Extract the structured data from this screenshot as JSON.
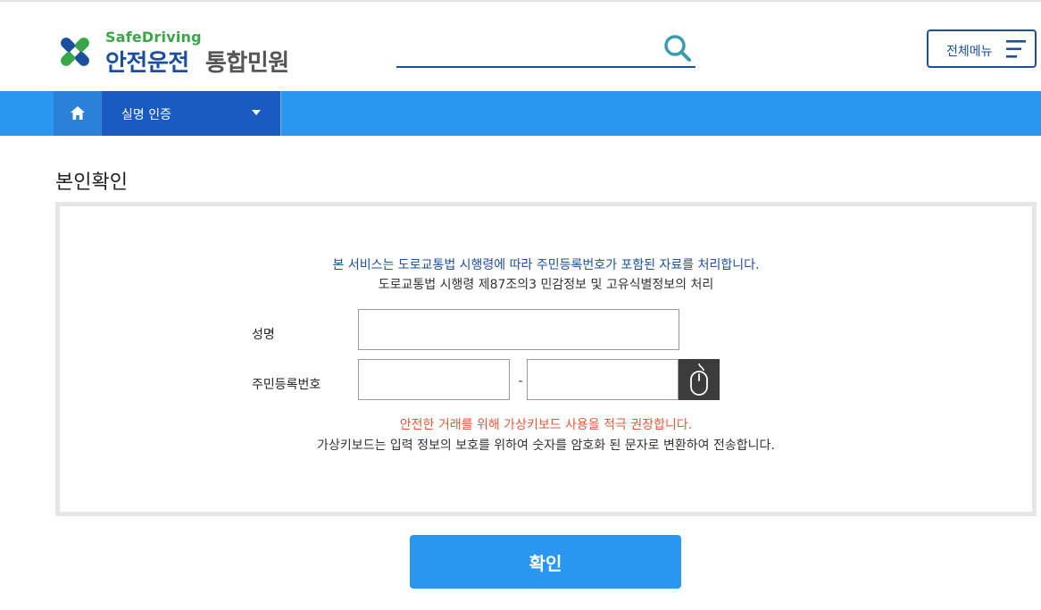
{
  "header": {
    "logo_small": "SafeDriving",
    "logo_main": "안전운전",
    "logo_sub": "통합민원",
    "search": {
      "placeholder": "",
      "icon": "search-icon"
    },
    "menu_button": {
      "label": "전체메뉴",
      "icon": "hamburger-icon"
    }
  },
  "nav": {
    "home_icon": "home-icon",
    "dropdown_label": "실명 인증",
    "dropdown_icon": "caret-down-icon"
  },
  "page": {
    "title": "본인확인"
  },
  "form": {
    "notice_primary": "본 서비스는 도로교통법 시행령에 따라 주민등록번호가 포함된 자료를 처리합니다.",
    "notice_secondary": "도로교통법 시행령 제87조의3 민감정보 및 고유식별정보의 처리",
    "name_label": "성명",
    "name_value": "",
    "rrn_label": "주민등록번호",
    "rrn_first_value": "",
    "rrn_dash": "-",
    "rrn_second_value": "",
    "virtual_keyboard_icon": "mouse-icon",
    "warning_primary": "안전한 거래를 위해 가상키보드 사용을 적극 권장합니다.",
    "warning_secondary": "가상키보드는 입력 정보의 보호를 위하여 숫자를 암호화 된 문자로 변환하여 전송합니다.",
    "confirm_label": "확인"
  },
  "colors": {
    "brand_blue": "#1d4f9e",
    "brand_green": "#3aa64a",
    "nav_blue": "#2b96f0",
    "nav_dark": "#1b5bbf",
    "warning_red": "#e05a3a"
  }
}
